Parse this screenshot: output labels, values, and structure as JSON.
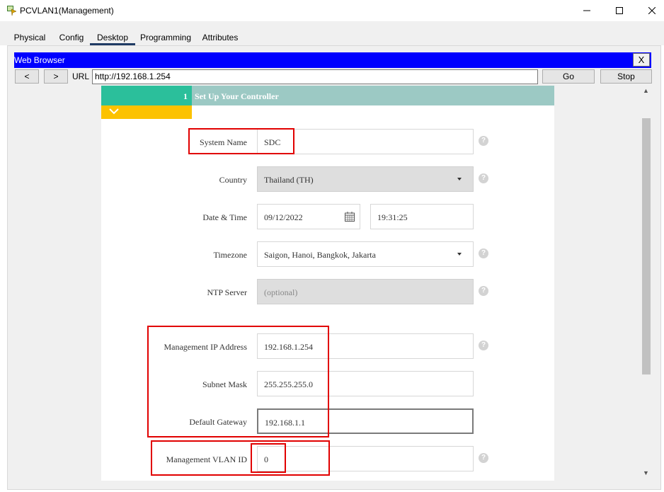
{
  "window": {
    "title": "PCVLAN1(Management)"
  },
  "tabs": [
    "Physical",
    "Config",
    "Desktop",
    "Programming",
    "Attributes"
  ],
  "active_tab": "Desktop",
  "web_browser": {
    "title": "Web Browser",
    "close_label": "X",
    "back_label": "<",
    "forward_label": ">",
    "url_label": "URL",
    "url": "http://192.168.1.254",
    "go_label": "Go",
    "stop_label": "Stop"
  },
  "wizard": {
    "step_number": "1",
    "step_title": "Set Up Your Controller",
    "fields": {
      "system_name": {
        "label": "System Name",
        "value": "SDC"
      },
      "country": {
        "label": "Country",
        "value": "Thailand (TH)"
      },
      "date_time": {
        "label": "Date & Time",
        "date": "09/12/2022",
        "time": "19:31:25"
      },
      "timezone": {
        "label": "Timezone",
        "value": "Saigon, Hanoi, Bangkok, Jakarta"
      },
      "ntp_server": {
        "label": "NTP Server",
        "placeholder": "(optional)"
      },
      "mgmt_ip": {
        "label": "Management IP Address",
        "value": "192.168.1.254"
      },
      "subnet_mask": {
        "label": "Subnet Mask",
        "value": "255.255.255.0"
      },
      "gateway": {
        "label": "Default Gateway",
        "value": "192.168.1.1"
      },
      "mgmt_vlan": {
        "label": "Management VLAN ID",
        "value": "0"
      }
    },
    "help_glyph": "?"
  },
  "colors": {
    "step_teal": "#2bbf9b",
    "step_bar": "#9cc9c4",
    "chevron_yellow": "#fcc200",
    "browser_title_blue": "#0000ff",
    "highlight_red": "#e10000"
  }
}
